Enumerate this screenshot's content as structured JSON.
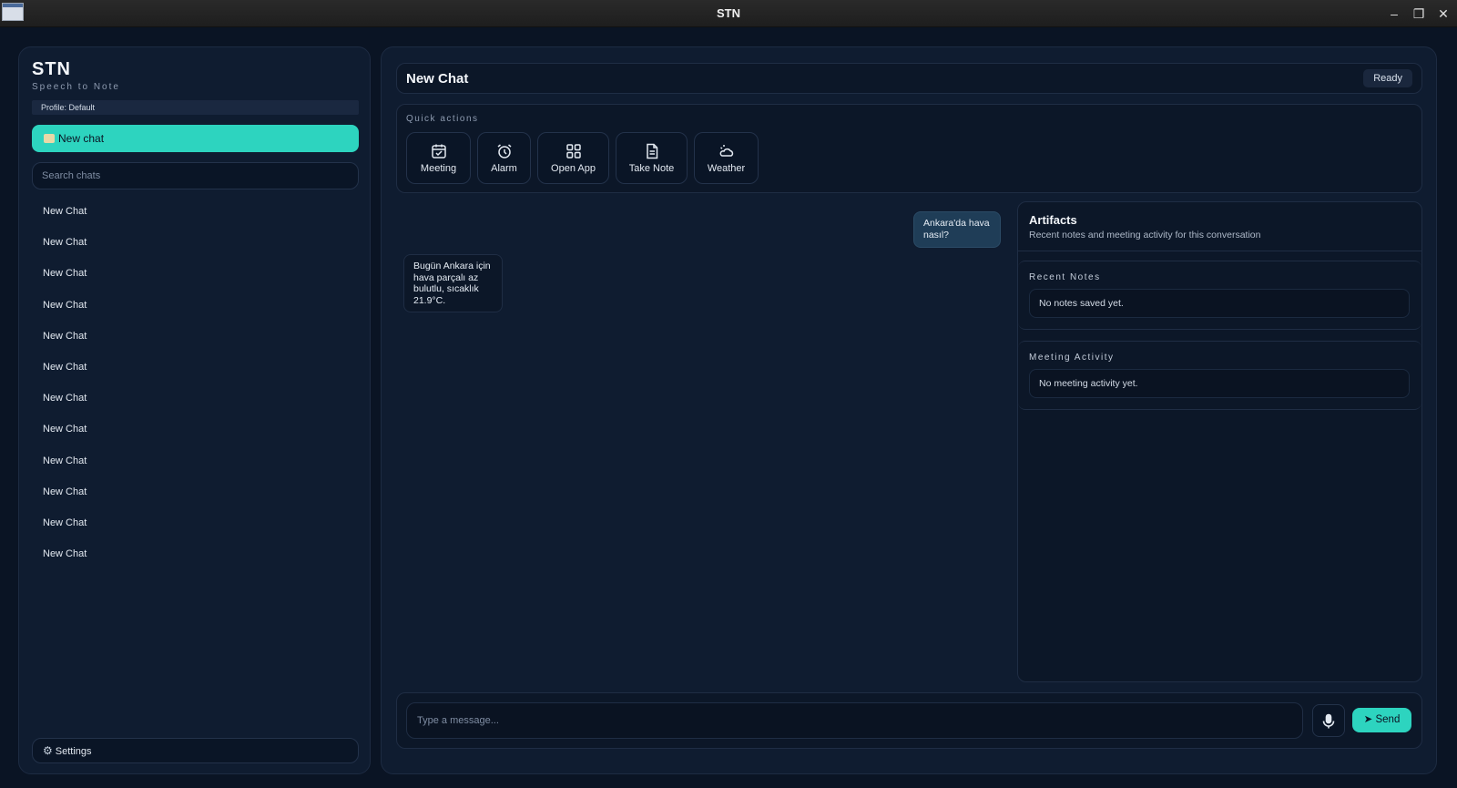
{
  "window": {
    "title": "STN",
    "minimize_icon": "minimize-icon",
    "maximize_icon": "maximize-icon",
    "close_icon": "close-icon"
  },
  "sidebar": {
    "brand_title": "STN",
    "brand_subtitle": "Speech to Note",
    "profile": "Profile: Default",
    "new_chat_label": "New chat",
    "search_placeholder": "Search chats",
    "chats": [
      "New Chat",
      "New Chat",
      "New Chat",
      "New Chat",
      "New Chat",
      "New Chat",
      "New Chat",
      "New Chat",
      "New Chat",
      "New Chat",
      "New Chat",
      "New Chat"
    ],
    "settings_label": "Settings"
  },
  "header": {
    "title": "New Chat",
    "status": "Ready"
  },
  "quick_actions": {
    "label": "Quick actions",
    "items": [
      {
        "label": "Meeting",
        "icon": "calendar-icon"
      },
      {
        "label": "Alarm",
        "icon": "alarm-clock-icon"
      },
      {
        "label": "Open App",
        "icon": "grid-icon"
      },
      {
        "label": "Take Note",
        "icon": "document-icon"
      },
      {
        "label": "Weather",
        "icon": "weather-icon"
      }
    ]
  },
  "messages": {
    "user": "Ankara'da hava nasıl?",
    "assistant": "Bugün Ankara için hava parçalı az bulutlu, sıcaklık 21.9°C."
  },
  "artifacts": {
    "title": "Artifacts",
    "subtitle": "Recent notes and meeting activity for this conversation",
    "recent_notes_label": "Recent Notes",
    "recent_notes_empty": "No notes saved yet.",
    "meeting_activity_label": "Meeting Activity",
    "meeting_activity_empty": "No meeting activity yet."
  },
  "composer": {
    "placeholder": "Type a message...",
    "send_label": "Send"
  },
  "colors": {
    "accent": "#2dd4bf",
    "background": "#0a1424",
    "panel": "#0f1c30"
  }
}
